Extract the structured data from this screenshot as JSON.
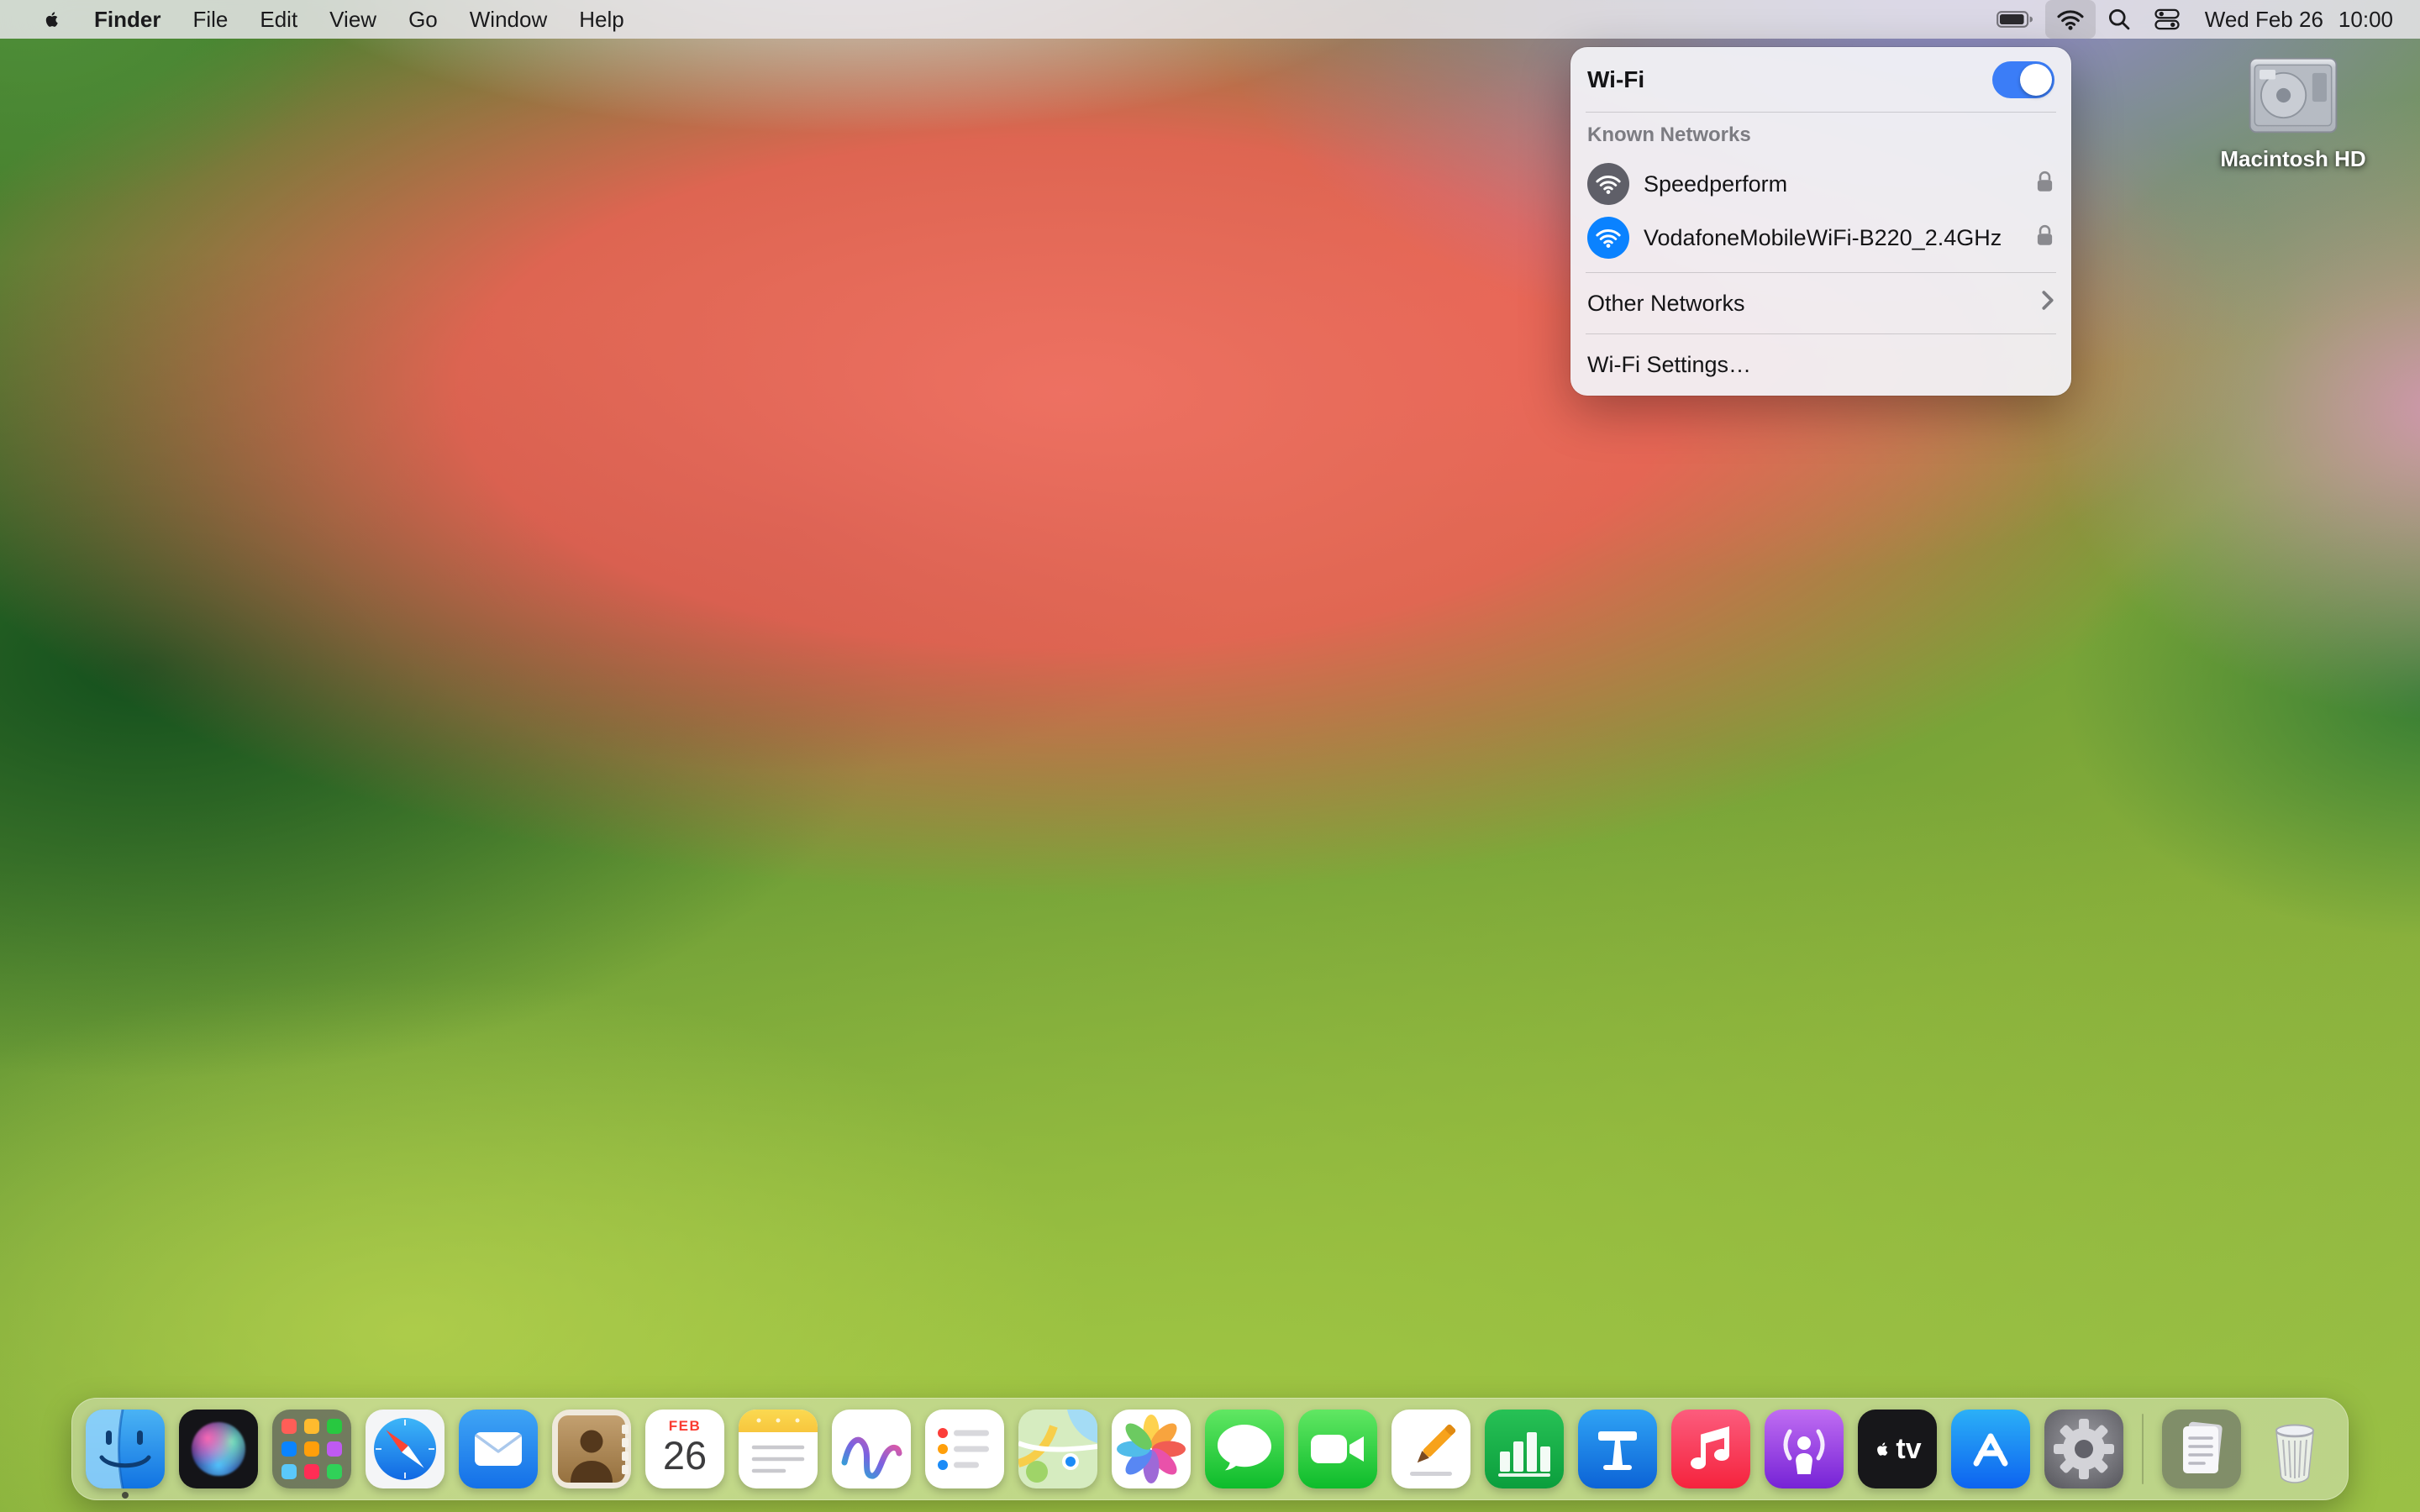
{
  "menu_bar": {
    "app_name": "Finder",
    "menus": [
      "File",
      "Edit",
      "View",
      "Go",
      "Window",
      "Help"
    ],
    "status_icons": [
      "battery-icon",
      "wifi-icon",
      "spotlight-search-icon",
      "control-center-icon"
    ],
    "date": "Wed Feb 26",
    "time": "10:00"
  },
  "wifi_menu": {
    "title": "Wi-Fi",
    "toggle_state": "on",
    "known_networks_label": "Known Networks",
    "networks": [
      {
        "name": "Speedperform",
        "secured": true,
        "icon": "wifi-circle-icon-gray"
      },
      {
        "name": "VodafoneMobileWiFi-B220_2.4GHz",
        "secured": true,
        "icon": "wifi-circle-icon-blue"
      }
    ],
    "other_networks_label": "Other Networks",
    "settings_label": "Wi-Fi Settings…"
  },
  "desktop": {
    "volume_label": "Macintosh HD"
  },
  "dock": {
    "items": [
      "finder",
      "siri",
      "launchpad",
      "safari",
      "mail",
      "contacts",
      "calendar",
      "notes",
      "freeform",
      "reminders",
      "maps",
      "photos",
      "messages",
      "facetime",
      "pages",
      "numbers",
      "keynote",
      "music",
      "podcasts",
      "apple-tv",
      "app-store",
      "system-settings",
      "downloads",
      "trash"
    ],
    "calendar": {
      "month": "FEB",
      "day": "26"
    },
    "tv_label": "tv",
    "running": [
      "finder"
    ]
  },
  "colors": {
    "accent_blue": "#0a82ff",
    "toggle_on": "#3b7df7",
    "connected_network_badge": "#0a82ff",
    "salmon_wave": "#f1605a",
    "lime_green": "#a2c844"
  }
}
